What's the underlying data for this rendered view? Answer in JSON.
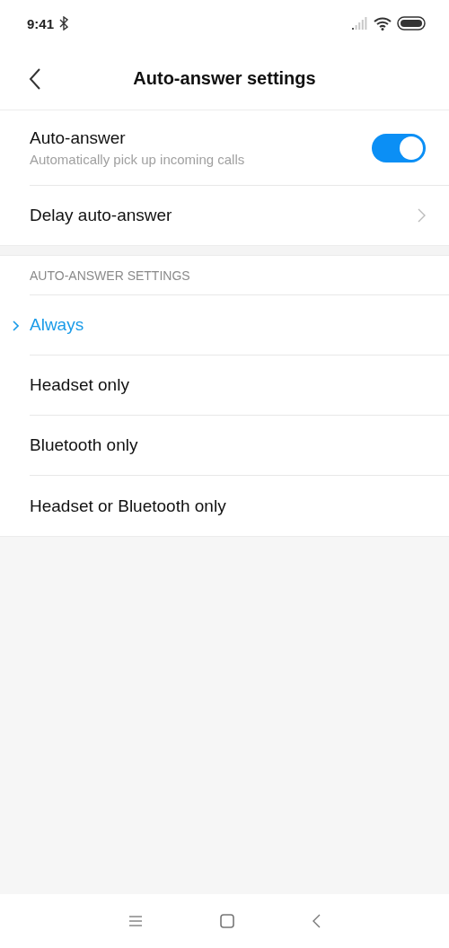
{
  "status_bar": {
    "time": "9:41"
  },
  "header": {
    "title": "Auto-answer settings"
  },
  "settings": [
    {
      "kind": "toggle",
      "label": "Auto-answer",
      "description": "Automatically pick up incoming calls",
      "on": true
    },
    {
      "kind": "link",
      "label": "Delay auto-answer"
    }
  ],
  "mode_section": {
    "heading": "AUTO-ANSWER SETTINGS",
    "options": [
      {
        "label": "Always",
        "selected": true
      },
      {
        "label": "Headset only",
        "selected": false
      },
      {
        "label": "Bluetooth only",
        "selected": false
      },
      {
        "label": "Headset or Bluetooth only",
        "selected": false
      }
    ]
  }
}
